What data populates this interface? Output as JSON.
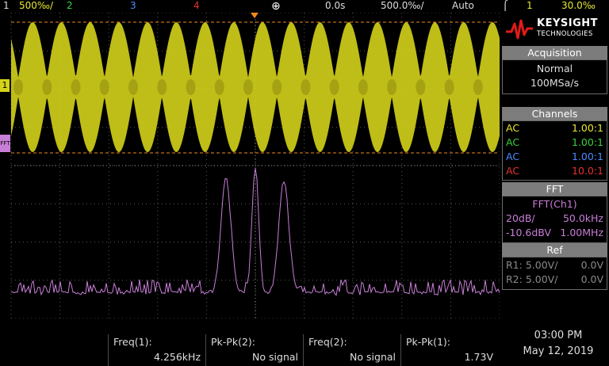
{
  "topbar": {
    "ch1_num": "1",
    "ch1_scale": "500‰/",
    "ch2_num": "2",
    "ch3_num": "3",
    "ch4_num": "4",
    "time_offset": "0.0s",
    "time_scale": "500.0‰/",
    "trigger_mode": "Auto",
    "trigger_ch": "1",
    "trigger_level": "30.0‰"
  },
  "brand": {
    "name": "KEYSIGHT",
    "sub": "TECHNOLOGIES"
  },
  "acquisition": {
    "header": "Acquisition",
    "mode": "Normal",
    "rate": "100MSa/s"
  },
  "channels": {
    "header": "Channels",
    "rows": [
      {
        "coupling": "AC",
        "ratio": "1.00:1",
        "color": "#e8e830"
      },
      {
        "coupling": "AC",
        "ratio": "1.00:1",
        "color": "#3ad23a"
      },
      {
        "coupling": "AC",
        "ratio": "1.00:1",
        "color": "#4a8cff"
      },
      {
        "coupling": "AC",
        "ratio": "10.0:1",
        "color": "#e83030"
      }
    ]
  },
  "fft": {
    "header": "FFT",
    "source": "FFT(Ch1)",
    "vscale": "20dB/",
    "hscale": "50.0kHz",
    "ref_level": "-10.6dBV",
    "center": "1.00MHz",
    "color": "#c77ed6"
  },
  "ref": {
    "header": "Ref",
    "r1_label": "R1:",
    "r1_scale": "5.00V/",
    "r1_offset": "0.0V",
    "r2_label": "R2:",
    "r2_scale": "5.00V/",
    "r2_offset": "0.0V"
  },
  "measurements": [
    {
      "label": "Freq(1):",
      "value": "4.256kHz"
    },
    {
      "label": "Pk-Pk(2):",
      "value": "No signal"
    },
    {
      "label": "Freq(2):",
      "value": "No signal"
    },
    {
      "label": "Pk-Pk(1):",
      "value": "1.73V"
    }
  ],
  "clock": {
    "time": "03:00 PM",
    "date": "May 12, 2019"
  },
  "markers": {
    "ch1": "1",
    "fft": "FFT"
  },
  "colors": {
    "ch1": "#d4d21a",
    "fft": "#c77ed6",
    "grid": "#5a5a5a",
    "trigger": "#f08a1e"
  }
}
